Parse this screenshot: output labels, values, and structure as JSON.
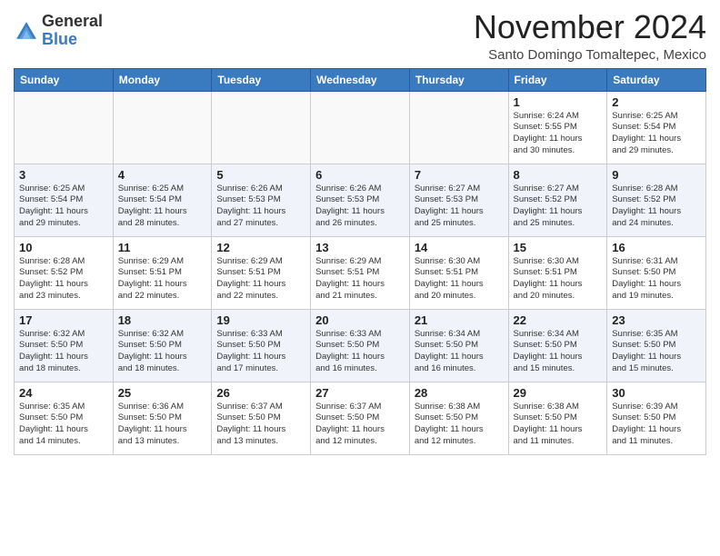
{
  "header": {
    "logo_general": "General",
    "logo_blue": "Blue",
    "month": "November 2024",
    "location": "Santo Domingo Tomaltepec, Mexico"
  },
  "weekdays": [
    "Sunday",
    "Monday",
    "Tuesday",
    "Wednesday",
    "Thursday",
    "Friday",
    "Saturday"
  ],
  "weeks": [
    [
      {
        "day": "",
        "info": ""
      },
      {
        "day": "",
        "info": ""
      },
      {
        "day": "",
        "info": ""
      },
      {
        "day": "",
        "info": ""
      },
      {
        "day": "",
        "info": ""
      },
      {
        "day": "1",
        "info": "Sunrise: 6:24 AM\nSunset: 5:55 PM\nDaylight: 11 hours\nand 30 minutes."
      },
      {
        "day": "2",
        "info": "Sunrise: 6:25 AM\nSunset: 5:54 PM\nDaylight: 11 hours\nand 29 minutes."
      }
    ],
    [
      {
        "day": "3",
        "info": "Sunrise: 6:25 AM\nSunset: 5:54 PM\nDaylight: 11 hours\nand 29 minutes."
      },
      {
        "day": "4",
        "info": "Sunrise: 6:25 AM\nSunset: 5:54 PM\nDaylight: 11 hours\nand 28 minutes."
      },
      {
        "day": "5",
        "info": "Sunrise: 6:26 AM\nSunset: 5:53 PM\nDaylight: 11 hours\nand 27 minutes."
      },
      {
        "day": "6",
        "info": "Sunrise: 6:26 AM\nSunset: 5:53 PM\nDaylight: 11 hours\nand 26 minutes."
      },
      {
        "day": "7",
        "info": "Sunrise: 6:27 AM\nSunset: 5:53 PM\nDaylight: 11 hours\nand 25 minutes."
      },
      {
        "day": "8",
        "info": "Sunrise: 6:27 AM\nSunset: 5:52 PM\nDaylight: 11 hours\nand 25 minutes."
      },
      {
        "day": "9",
        "info": "Sunrise: 6:28 AM\nSunset: 5:52 PM\nDaylight: 11 hours\nand 24 minutes."
      }
    ],
    [
      {
        "day": "10",
        "info": "Sunrise: 6:28 AM\nSunset: 5:52 PM\nDaylight: 11 hours\nand 23 minutes."
      },
      {
        "day": "11",
        "info": "Sunrise: 6:29 AM\nSunset: 5:51 PM\nDaylight: 11 hours\nand 22 minutes."
      },
      {
        "day": "12",
        "info": "Sunrise: 6:29 AM\nSunset: 5:51 PM\nDaylight: 11 hours\nand 22 minutes."
      },
      {
        "day": "13",
        "info": "Sunrise: 6:29 AM\nSunset: 5:51 PM\nDaylight: 11 hours\nand 21 minutes."
      },
      {
        "day": "14",
        "info": "Sunrise: 6:30 AM\nSunset: 5:51 PM\nDaylight: 11 hours\nand 20 minutes."
      },
      {
        "day": "15",
        "info": "Sunrise: 6:30 AM\nSunset: 5:51 PM\nDaylight: 11 hours\nand 20 minutes."
      },
      {
        "day": "16",
        "info": "Sunrise: 6:31 AM\nSunset: 5:50 PM\nDaylight: 11 hours\nand 19 minutes."
      }
    ],
    [
      {
        "day": "17",
        "info": "Sunrise: 6:32 AM\nSunset: 5:50 PM\nDaylight: 11 hours\nand 18 minutes."
      },
      {
        "day": "18",
        "info": "Sunrise: 6:32 AM\nSunset: 5:50 PM\nDaylight: 11 hours\nand 18 minutes."
      },
      {
        "day": "19",
        "info": "Sunrise: 6:33 AM\nSunset: 5:50 PM\nDaylight: 11 hours\nand 17 minutes."
      },
      {
        "day": "20",
        "info": "Sunrise: 6:33 AM\nSunset: 5:50 PM\nDaylight: 11 hours\nand 16 minutes."
      },
      {
        "day": "21",
        "info": "Sunrise: 6:34 AM\nSunset: 5:50 PM\nDaylight: 11 hours\nand 16 minutes."
      },
      {
        "day": "22",
        "info": "Sunrise: 6:34 AM\nSunset: 5:50 PM\nDaylight: 11 hours\nand 15 minutes."
      },
      {
        "day": "23",
        "info": "Sunrise: 6:35 AM\nSunset: 5:50 PM\nDaylight: 11 hours\nand 15 minutes."
      }
    ],
    [
      {
        "day": "24",
        "info": "Sunrise: 6:35 AM\nSunset: 5:50 PM\nDaylight: 11 hours\nand 14 minutes."
      },
      {
        "day": "25",
        "info": "Sunrise: 6:36 AM\nSunset: 5:50 PM\nDaylight: 11 hours\nand 13 minutes."
      },
      {
        "day": "26",
        "info": "Sunrise: 6:37 AM\nSunset: 5:50 PM\nDaylight: 11 hours\nand 13 minutes."
      },
      {
        "day": "27",
        "info": "Sunrise: 6:37 AM\nSunset: 5:50 PM\nDaylight: 11 hours\nand 12 minutes."
      },
      {
        "day": "28",
        "info": "Sunrise: 6:38 AM\nSunset: 5:50 PM\nDaylight: 11 hours\nand 12 minutes."
      },
      {
        "day": "29",
        "info": "Sunrise: 6:38 AM\nSunset: 5:50 PM\nDaylight: 11 hours\nand 11 minutes."
      },
      {
        "day": "30",
        "info": "Sunrise: 6:39 AM\nSunset: 5:50 PM\nDaylight: 11 hours\nand 11 minutes."
      }
    ]
  ]
}
